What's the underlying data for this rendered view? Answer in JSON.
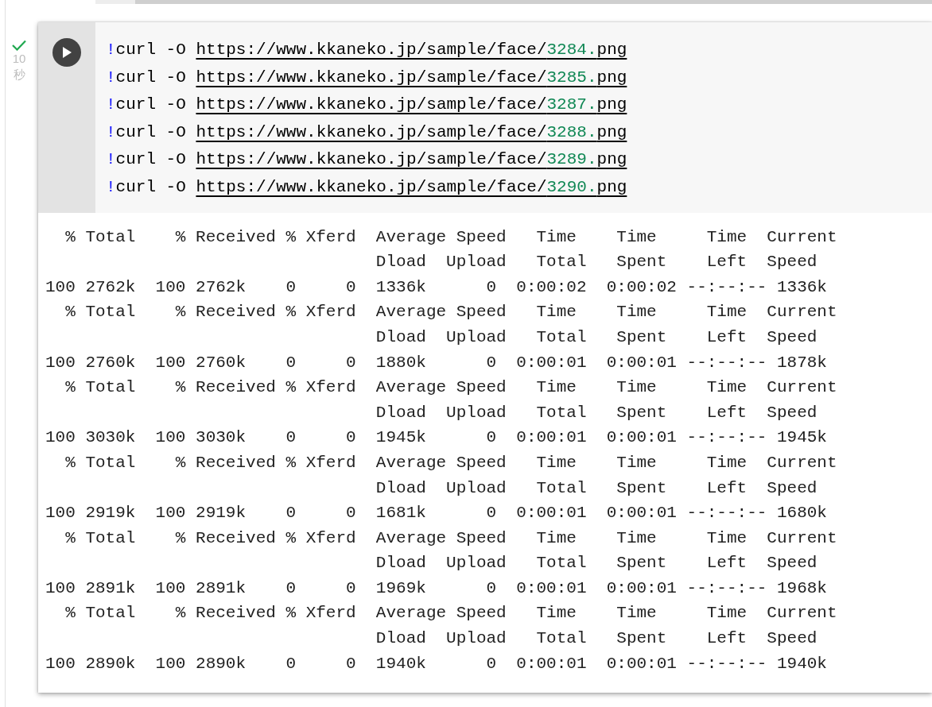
{
  "cell": {
    "succeeded": true,
    "elapsed": "10秒",
    "code_lines": [
      {
        "bang": "!",
        "command": "curl -O ",
        "url_start": "https://www.kkaneko.jp/sample/face/",
        "url_number": "3284.",
        "url_end": "png"
      },
      {
        "bang": "!",
        "command": "curl -O ",
        "url_start": "https://www.kkaneko.jp/sample/face/",
        "url_number": "3285.",
        "url_end": "png"
      },
      {
        "bang": "!",
        "command": "curl -O ",
        "url_start": "https://www.kkaneko.jp/sample/face/",
        "url_number": "3287.",
        "url_end": "png"
      },
      {
        "bang": "!",
        "command": "curl -O ",
        "url_start": "https://www.kkaneko.jp/sample/face/",
        "url_number": "3288.",
        "url_end": "png"
      },
      {
        "bang": "!",
        "command": "curl -O ",
        "url_start": "https://www.kkaneko.jp/sample/face/",
        "url_number": "3289.",
        "url_end": "png"
      },
      {
        "bang": "!",
        "command": "curl -O ",
        "url_start": "https://www.kkaneko.jp/sample/face/",
        "url_number": "3290.",
        "url_end": "png"
      }
    ],
    "output_lines": [
      "  % Total    % Received % Xferd  Average Speed   Time    Time     Time  Current",
      "                                 Dload  Upload   Total   Spent    Left  Speed",
      "100 2762k  100 2762k    0     0  1336k      0  0:00:02  0:00:02 --:--:-- 1336k",
      "  % Total    % Received % Xferd  Average Speed   Time    Time     Time  Current",
      "                                 Dload  Upload   Total   Spent    Left  Speed",
      "100 2760k  100 2760k    0     0  1880k      0  0:00:01  0:00:01 --:--:-- 1878k",
      "  % Total    % Received % Xferd  Average Speed   Time    Time     Time  Current",
      "                                 Dload  Upload   Total   Spent    Left  Speed",
      "100 3030k  100 3030k    0     0  1945k      0  0:00:01  0:00:01 --:--:-- 1945k",
      "  % Total    % Received % Xferd  Average Speed   Time    Time     Time  Current",
      "                                 Dload  Upload   Total   Spent    Left  Speed",
      "100 2919k  100 2919k    0     0  1681k      0  0:00:01  0:00:01 --:--:-- 1680k",
      "  % Total    % Received % Xferd  Average Speed   Time    Time     Time  Current",
      "                                 Dload  Upload   Total   Spent    Left  Speed",
      "100 2891k  100 2891k    0     0  1969k      0  0:00:01  0:00:01 --:--:-- 1968k",
      "  % Total    % Received % Xferd  Average Speed   Time    Time     Time  Current",
      "                                 Dload  Upload   Total   Spent    Left  Speed",
      "100 2890k  100 2890k    0     0  1940k      0  0:00:01  0:00:01 --:--:-- 1940k"
    ]
  }
}
